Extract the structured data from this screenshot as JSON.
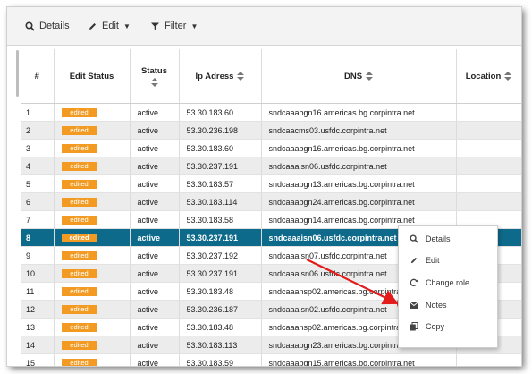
{
  "toolbar": {
    "details_label": "Details",
    "edit_label": "Edit",
    "filter_label": "Filter"
  },
  "columns": {
    "num": "#",
    "edit_status": "Edit Status",
    "status": "Status",
    "ip": "Ip Adress",
    "dns": "DNS",
    "location": "Location"
  },
  "rows": [
    {
      "num": "1",
      "edit_status": "edited",
      "status": "active",
      "ip": "53.30.183.60",
      "dns": "sndcaaabgn16.americas.bg.corpintra.net",
      "location": ""
    },
    {
      "num": "2",
      "edit_status": "edited",
      "status": "active",
      "ip": "53.30.236.198",
      "dns": "sndcaacms03.usfdc.corpintra.net",
      "location": ""
    },
    {
      "num": "3",
      "edit_status": "edited",
      "status": "active",
      "ip": "53.30.183.60",
      "dns": "sndcaaabgn16.americas.bg.corpintra.net",
      "location": ""
    },
    {
      "num": "4",
      "edit_status": "edited",
      "status": "active",
      "ip": "53.30.237.191",
      "dns": "sndcaaaisn06.usfdc.corpintra.net",
      "location": ""
    },
    {
      "num": "5",
      "edit_status": "edited",
      "status": "active",
      "ip": "53.30.183.57",
      "dns": "sndcaaabgn13.americas.bg.corpintra.net",
      "location": ""
    },
    {
      "num": "6",
      "edit_status": "edited",
      "status": "active",
      "ip": "53.30.183.114",
      "dns": "sndcaaabgn24.americas.bg.corpintra.net",
      "location": ""
    },
    {
      "num": "7",
      "edit_status": "edited",
      "status": "active",
      "ip": "53.30.183.58",
      "dns": "sndcaaabgn14.americas.bg.corpintra.net",
      "location": ""
    },
    {
      "num": "8",
      "edit_status": "edited",
      "status": "active",
      "ip": "53.30.237.191",
      "dns": "sndcaaaisn06.usfdc.corpintra.net",
      "location": ""
    },
    {
      "num": "9",
      "edit_status": "edited",
      "status": "active",
      "ip": "53.30.237.192",
      "dns": "sndcaaaisn07.usfdc.corpintra.net",
      "location": ""
    },
    {
      "num": "10",
      "edit_status": "edited",
      "status": "active",
      "ip": "53.30.237.191",
      "dns": "sndcaaaisn06.usfdc.corpintra.net",
      "location": ""
    },
    {
      "num": "11",
      "edit_status": "edited",
      "status": "active",
      "ip": "53.30.183.48",
      "dns": "sndcaaansp02.americas.bg.corpintra.net",
      "location": ""
    },
    {
      "num": "12",
      "edit_status": "edited",
      "status": "active",
      "ip": "53.30.236.187",
      "dns": "sndcaaaisn02.usfdc.corpintra.net",
      "location": ""
    },
    {
      "num": "13",
      "edit_status": "edited",
      "status": "active",
      "ip": "53.30.183.48",
      "dns": "sndcaaansp02.americas.bg.corpintra.net",
      "location": ""
    },
    {
      "num": "14",
      "edit_status": "edited",
      "status": "active",
      "ip": "53.30.183.113",
      "dns": "sndcaaabgn23.americas.bg.corpintra.net",
      "location": ""
    },
    {
      "num": "15",
      "edit_status": "edited",
      "status": "active",
      "ip": "53.30.183.59",
      "dns": "sndcaaabgn15.americas.bg.corpintra.net",
      "location": ""
    }
  ],
  "selected_row": "8",
  "context_menu": {
    "items": [
      {
        "label": "Details",
        "icon": "search-icon"
      },
      {
        "label": "Edit",
        "icon": "pencil-icon"
      },
      {
        "label": "Change role",
        "icon": "refresh-icon"
      },
      {
        "label": "Notes",
        "icon": "envelope-icon"
      },
      {
        "label": "Copy",
        "icon": "copy-icon"
      }
    ]
  },
  "colors": {
    "selected_row": "#0e6a8a",
    "edited_badge": "#f29a22",
    "annotation": "#e31b1b"
  }
}
